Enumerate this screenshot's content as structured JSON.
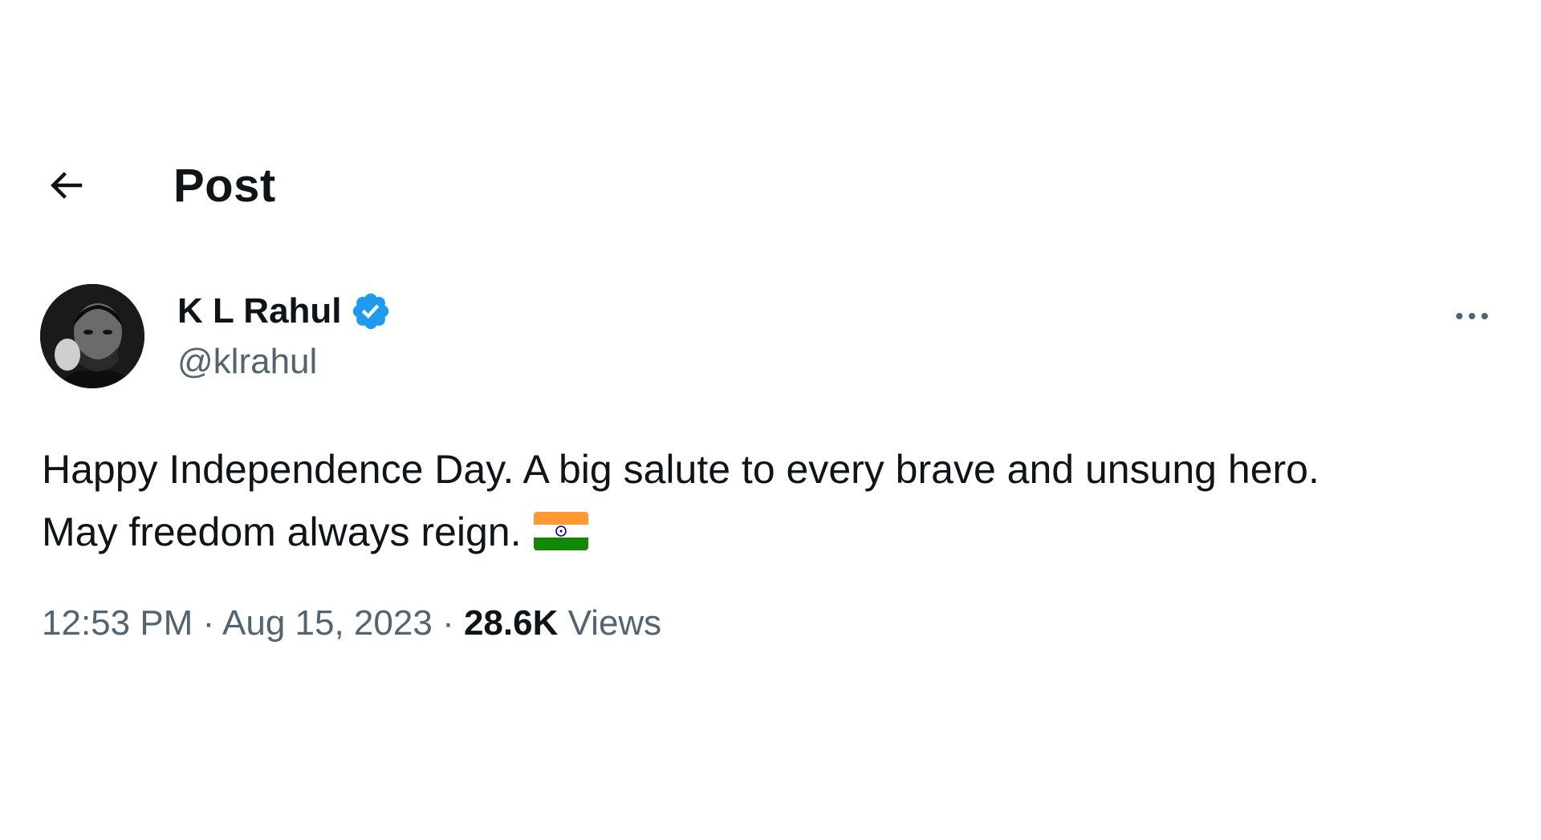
{
  "header": {
    "title": "Post"
  },
  "author": {
    "display_name": "K L Rahul",
    "handle": "@klrahul",
    "verified": true
  },
  "tweet": {
    "text_line1": "Happy Independence Day. A big salute to every brave and unsung hero.",
    "text_line2": "May freedom always reign.",
    "emoji": "india-flag"
  },
  "meta": {
    "time": "12:53 PM",
    "separator": "·",
    "date": "Aug 15, 2023",
    "views_count": "28.6K",
    "views_label": "Views"
  },
  "colors": {
    "primary_text": "#0f1419",
    "secondary_text": "#536471",
    "verified_blue": "#1d9bf0"
  }
}
